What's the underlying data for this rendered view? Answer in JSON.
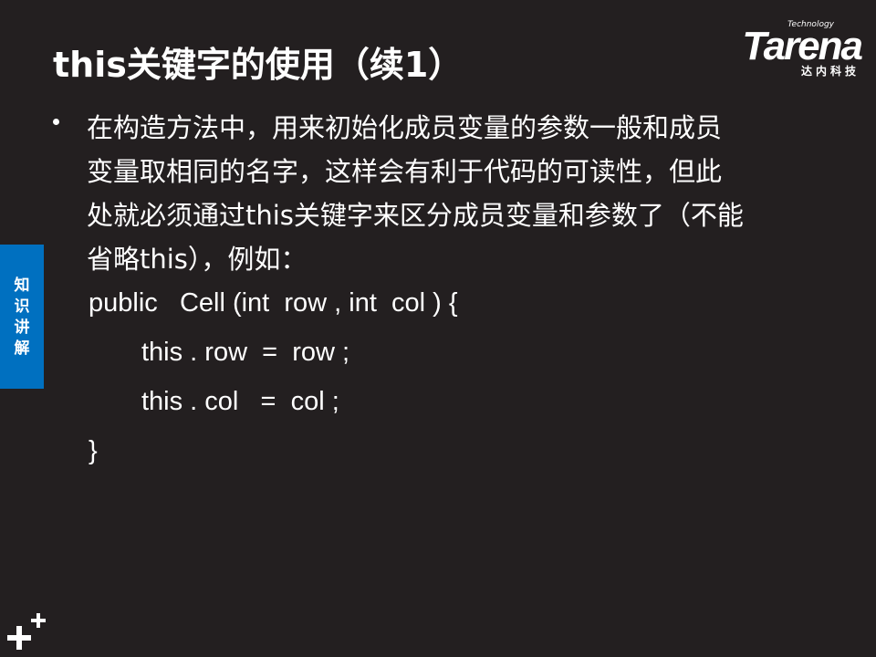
{
  "slide": {
    "title": "this关键字的使用（续1）"
  },
  "logo": {
    "technology": "Technology",
    "name": "Tarena",
    "subtitle": "达内科技"
  },
  "side_tab": {
    "chars": [
      "知",
      "识",
      "讲",
      "解"
    ]
  },
  "body": {
    "lines": [
      "在构造方法中，用来初始化成员变量的参数一般和成员",
      "变量取相同的名字，这样会有利于代码的可读性，但此",
      "处就必须通过this关键字来区分成员变量和参数了（不能",
      "省略this），例如："
    ]
  },
  "code": {
    "lines": [
      "public   Cell (int  row , int  col ) {",
      "this . row  =  row ;",
      "this . col   =  col ;",
      "}"
    ]
  },
  "colors": {
    "background": "#231f20",
    "side_tab": "#0070c0",
    "text": "#ffffff"
  }
}
